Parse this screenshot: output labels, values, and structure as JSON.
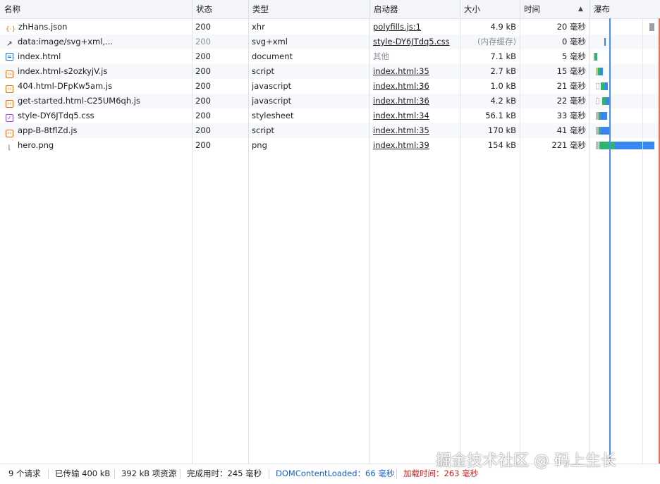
{
  "columns": {
    "name": "名称",
    "status": "状态",
    "type": "类型",
    "initiator": "启动器",
    "size": "大小",
    "time": "时间",
    "waterfall": "瀑布"
  },
  "rows": [
    {
      "icon": "json-icon",
      "name": "zhHans.json",
      "status": "200",
      "type": "xhr",
      "initiator": "polyfills.js:1",
      "size": "4.9 kB",
      "time": "20 毫秒"
    },
    {
      "icon": "data-url-icon",
      "name": "data:image/svg+xml,...",
      "status": "200",
      "type": "svg+xml",
      "initiator": "style-DY6JTdq5.css",
      "size": "(内存缓存)",
      "time": "0 毫秒"
    },
    {
      "icon": "document-icon",
      "name": "index.html",
      "status": "200",
      "type": "document",
      "initiator": "其他",
      "size": "7.1 kB",
      "time": "5 毫秒"
    },
    {
      "icon": "script-icon",
      "name": "index.html-s2ozkyjV.js",
      "status": "200",
      "type": "script",
      "initiator": "index.html:35",
      "size": "2.7 kB",
      "time": "15 毫秒"
    },
    {
      "icon": "script-icon",
      "name": "404.html-DFpKw5am.js",
      "status": "200",
      "type": "javascript",
      "initiator": "index.html:36",
      "size": "1.0 kB",
      "time": "21 毫秒"
    },
    {
      "icon": "script-icon",
      "name": "get-started.html-C25UM6qh.js",
      "status": "200",
      "type": "javascript",
      "initiator": "index.html:36",
      "size": "4.2 kB",
      "time": "22 毫秒"
    },
    {
      "icon": "stylesheet-icon",
      "name": "style-DY6JTdq5.css",
      "status": "200",
      "type": "stylesheet",
      "initiator": "index.html:34",
      "size": "56.1 kB",
      "time": "33 毫秒"
    },
    {
      "icon": "script-icon",
      "name": "app-B-8tflZd.js",
      "status": "200",
      "type": "script",
      "initiator": "index.html:35",
      "size": "170 kB",
      "time": "41 毫秒"
    },
    {
      "icon": "image-icon",
      "name": "hero.png",
      "status": "200",
      "type": "png",
      "initiator": "index.html:39",
      "size": "154 kB",
      "time": "221 毫秒"
    }
  ],
  "footer": {
    "requests": "9 个请求",
    "transferred": "已传输 400 kB",
    "resources": "392 kB 项资源",
    "finish": "完成用时：245 毫秒",
    "dom_content_loaded": "DOMContentLoaded：66 毫秒",
    "load": "加载时间：263 毫秒"
  },
  "watermark": "掘金技术社区 @ 码上生长",
  "colors": {
    "header_bg": "#f3f5f9",
    "waiting": "#2fb46c",
    "download": "#3a86f0",
    "queue": "#9aa0a6",
    "dom_line": "#4a8ef0",
    "load_line": "#e2735d"
  }
}
